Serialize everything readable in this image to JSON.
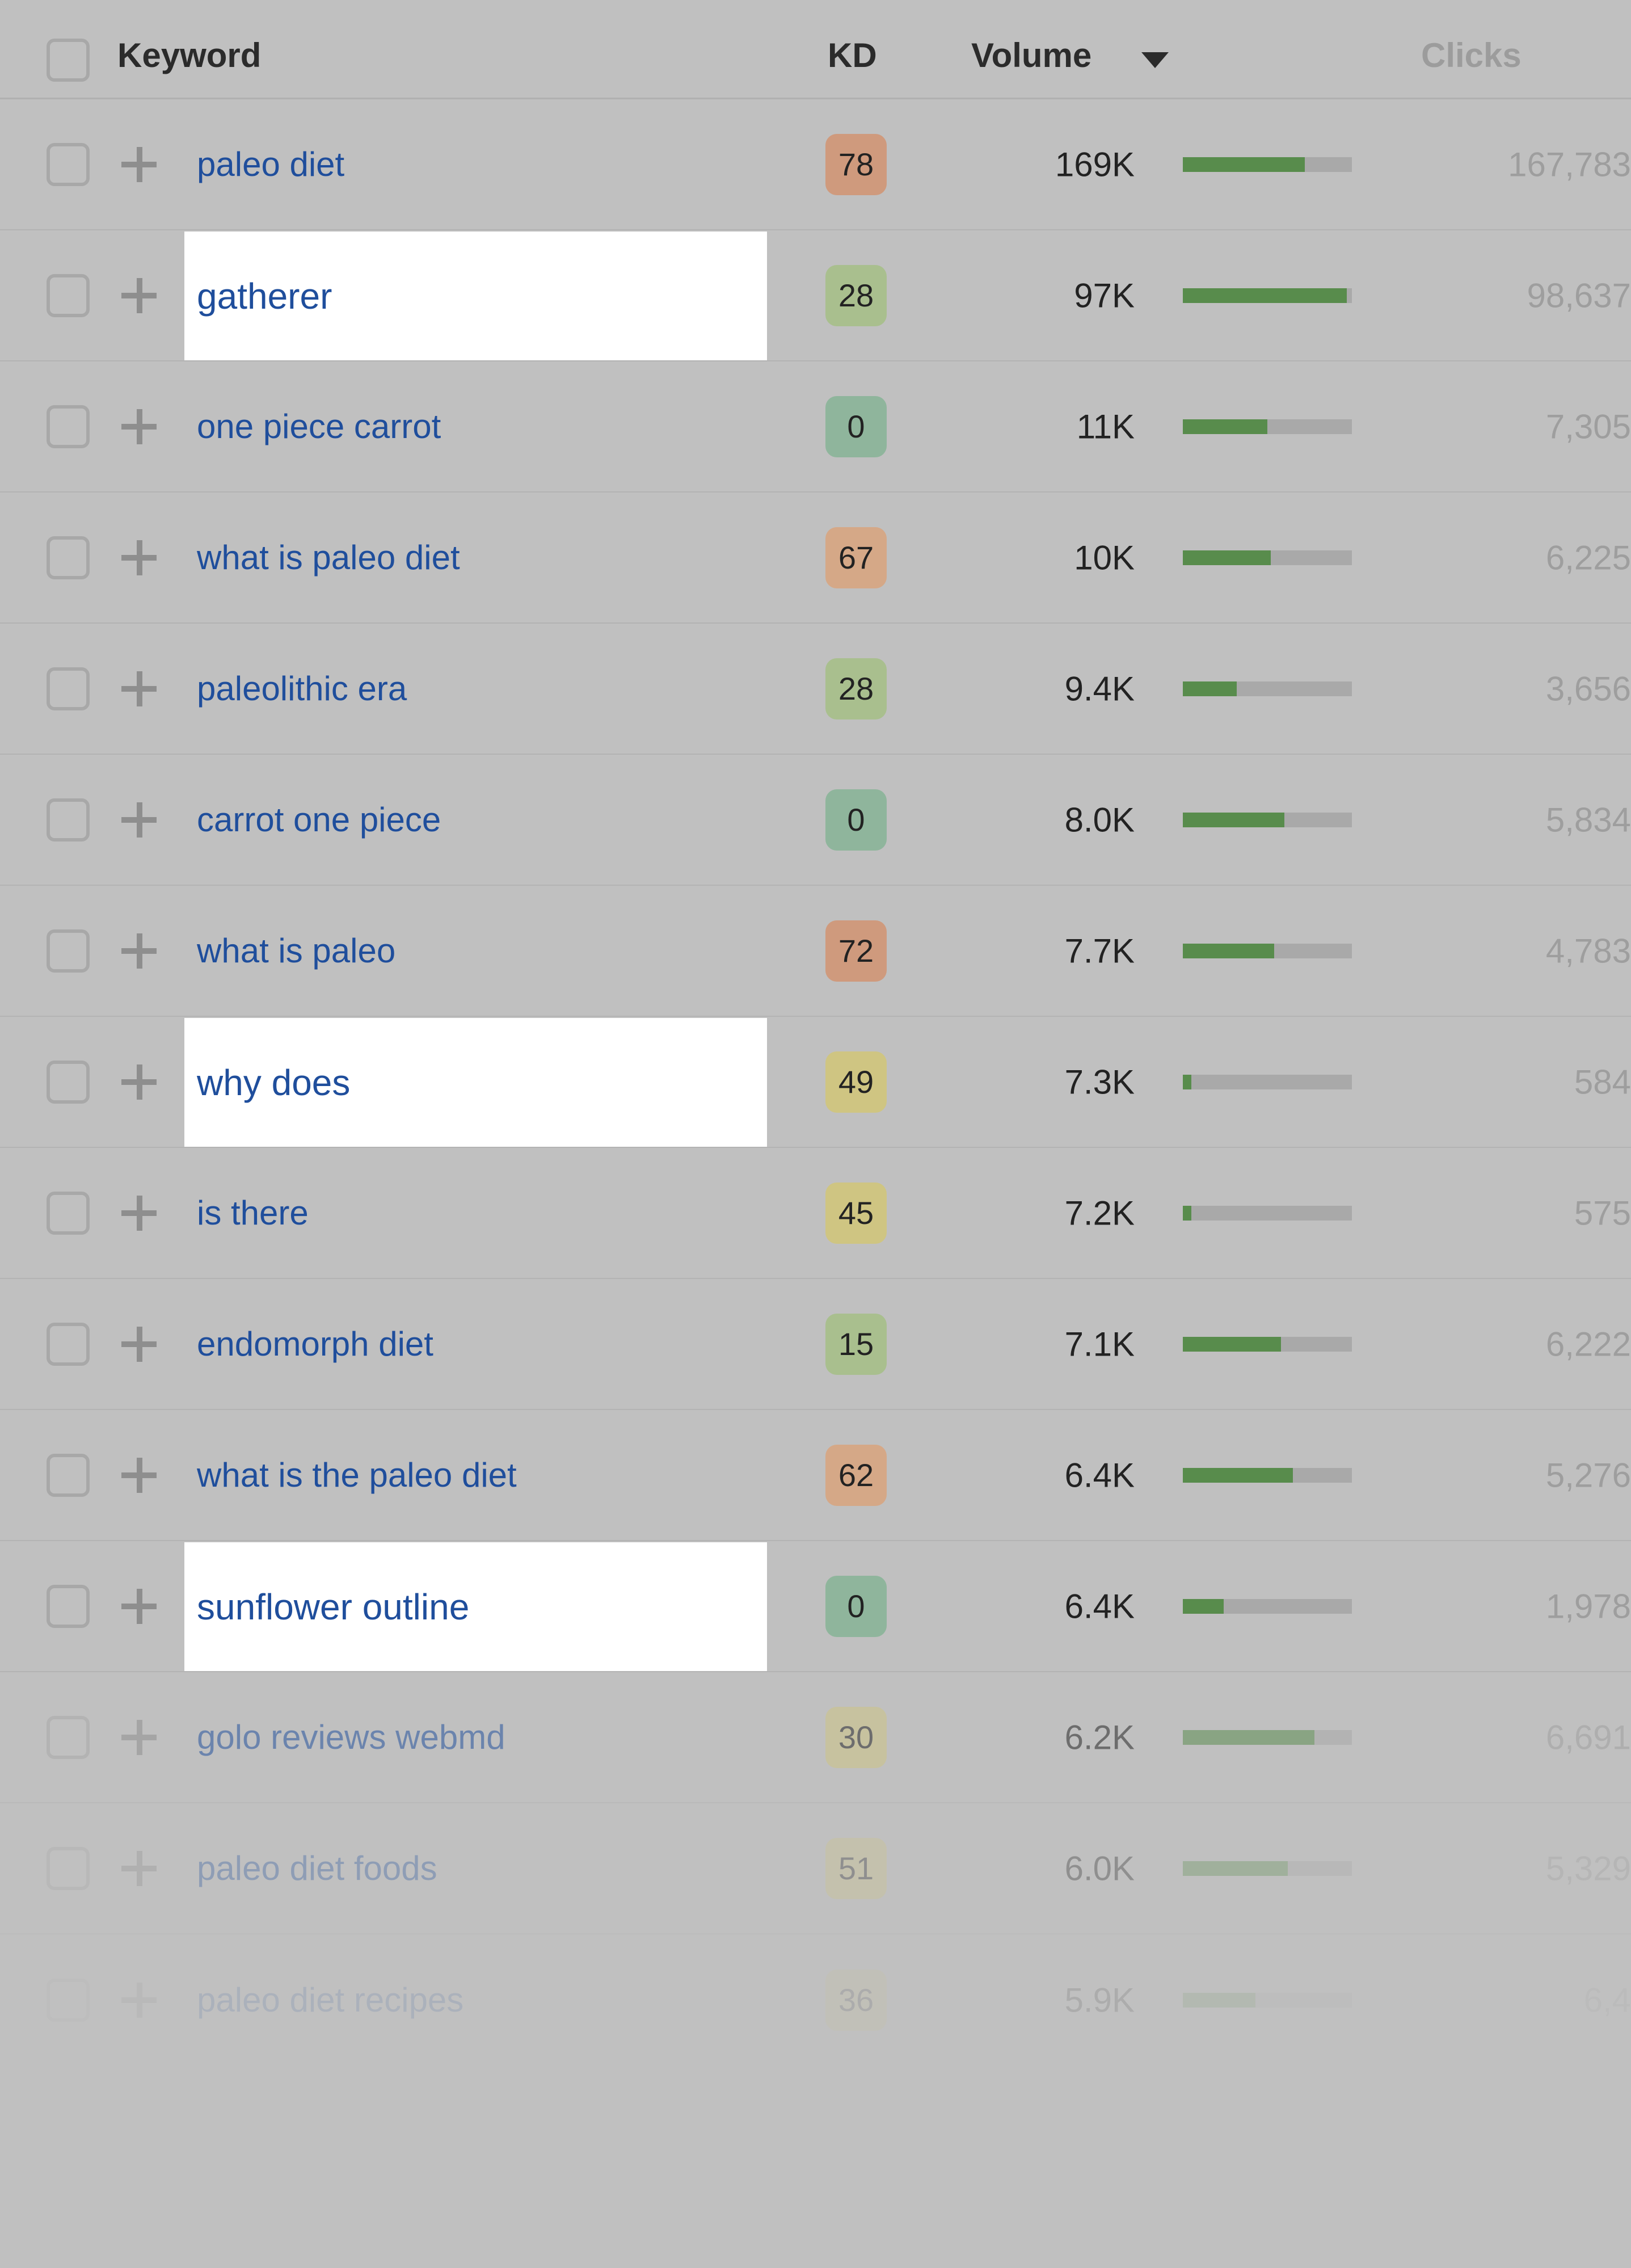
{
  "table": {
    "headers": {
      "select_all": "",
      "keyword": "Keyword",
      "kd": "KD",
      "volume": "Volume",
      "clicks": "Clicks",
      "sort_icon": "caret-down-icon",
      "sorted_by": "Volume",
      "sort_direction": "descending"
    },
    "colors": {
      "page_background": "#c0c0c0",
      "keyword_link": "#1f4e9c",
      "bar_fill": "#588c4c",
      "bar_track": "#a9a9a9",
      "header_text": "#2b2b2b",
      "clicks_text": "#9e9e9e",
      "highlight_background": "#ffffff",
      "kd_easy": "#8fb59c",
      "kd_low": "#a9bf8e",
      "kd_medium": "#cfc582",
      "kd_hard": "#d5a887",
      "kd_very_hard": "#cf9a7d"
    },
    "add_icon": "plus-icon",
    "checkbox_icon": "checkbox-unchecked-icon",
    "rows": [
      {
        "keyword": "paleo diet",
        "kd": "78",
        "kd_color": "#cf9a7d",
        "volume": "169K",
        "bar_pct": 72,
        "clicks": "167,783",
        "highlight": false,
        "fade": 0
      },
      {
        "keyword": "gatherer",
        "kd": "28",
        "kd_color": "#a9bf8e",
        "volume": "97K",
        "bar_pct": 97,
        "clicks": "98,637",
        "highlight": true,
        "fade": 0
      },
      {
        "keyword": "one piece carrot",
        "kd": "0",
        "kd_color": "#8fb59c",
        "volume": "11K",
        "bar_pct": 50,
        "clicks": "7,305",
        "highlight": false,
        "fade": 0
      },
      {
        "keyword": "what is paleo diet",
        "kd": "67",
        "kd_color": "#d5a887",
        "volume": "10K",
        "bar_pct": 52,
        "clicks": "6,225",
        "highlight": false,
        "fade": 0
      },
      {
        "keyword": "paleolithic era",
        "kd": "28",
        "kd_color": "#a9bf8e",
        "volume": "9.4K",
        "bar_pct": 32,
        "clicks": "3,656",
        "highlight": false,
        "fade": 0
      },
      {
        "keyword": "carrot one piece",
        "kd": "0",
        "kd_color": "#8fb59c",
        "volume": "8.0K",
        "bar_pct": 60,
        "clicks": "5,834",
        "highlight": false,
        "fade": 0
      },
      {
        "keyword": "what is paleo",
        "kd": "72",
        "kd_color": "#cf9a7d",
        "volume": "7.7K",
        "bar_pct": 54,
        "clicks": "4,783",
        "highlight": false,
        "fade": 0
      },
      {
        "keyword": "why does",
        "kd": "49",
        "kd_color": "#cfc582",
        "volume": "7.3K",
        "bar_pct": 5,
        "clicks": "584",
        "highlight": true,
        "fade": 0
      },
      {
        "keyword": "is there",
        "kd": "45",
        "kd_color": "#cfc582",
        "volume": "7.2K",
        "bar_pct": 5,
        "clicks": "575",
        "highlight": false,
        "fade": 0
      },
      {
        "keyword": "endomorph diet",
        "kd": "15",
        "kd_color": "#a9bf8e",
        "volume": "7.1K",
        "bar_pct": 58,
        "clicks": "6,222",
        "highlight": false,
        "fade": 0
      },
      {
        "keyword": "what is the paleo diet",
        "kd": "62",
        "kd_color": "#d5a887",
        "volume": "6.4K",
        "bar_pct": 65,
        "clicks": "5,276",
        "highlight": false,
        "fade": 0
      },
      {
        "keyword": "sunflower outline",
        "kd": "0",
        "kd_color": "#8fb59c",
        "volume": "6.4K",
        "bar_pct": 24,
        "clicks": "1,978",
        "highlight": true,
        "fade": 0
      },
      {
        "keyword": "golo reviews webmd",
        "kd": "30",
        "kd_color": "#cfc582",
        "volume": "6.2K",
        "bar_pct": 78,
        "clicks": "6,691",
        "highlight": false,
        "fade": 1
      },
      {
        "keyword": "paleo diet foods",
        "kd": "51",
        "kd_color": "#cfc582",
        "volume": "6.0K",
        "bar_pct": 62,
        "clicks": "5,329",
        "highlight": false,
        "fade": 2
      },
      {
        "keyword": "paleo diet recipes",
        "kd": "36",
        "kd_color": "#cfc582",
        "volume": "5.9K",
        "bar_pct": 43,
        "clicks": "6,4",
        "highlight": false,
        "fade": 3
      }
    ]
  }
}
